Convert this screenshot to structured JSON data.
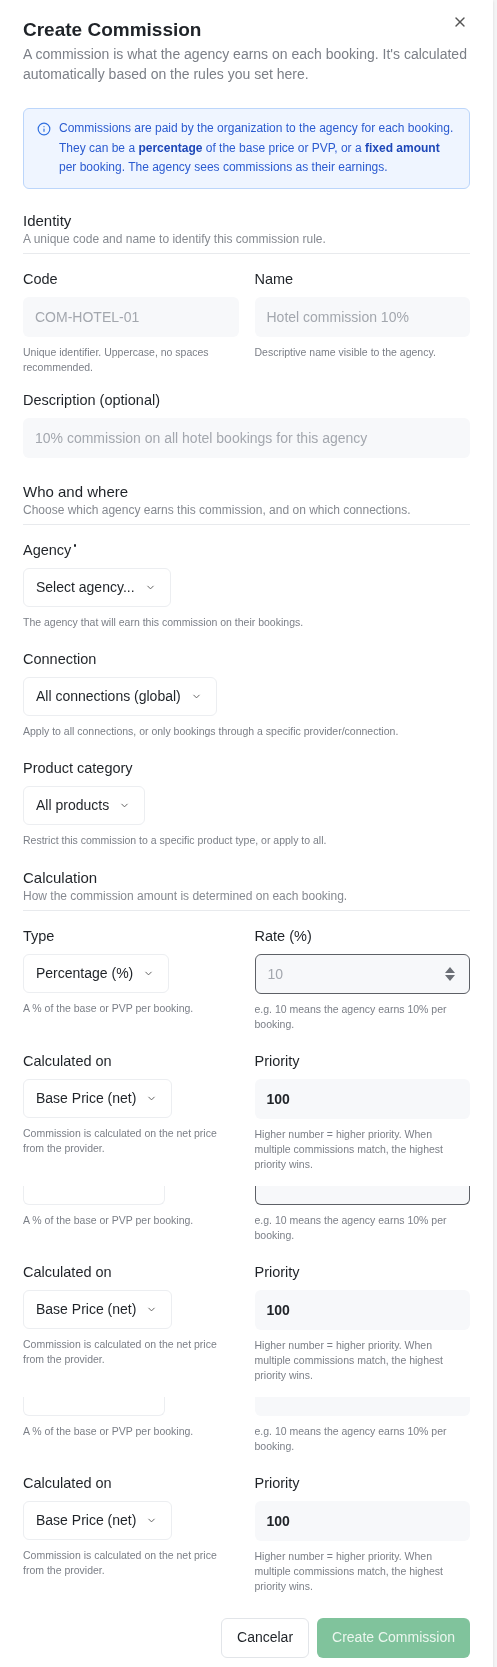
{
  "dialog": {
    "title": "Create Commission",
    "subtitle": "A commission is what the agency earns on each booking. It's calculated automatically based on the rules you set here.",
    "info": "Commissions are paid by the organization to the agency for each booking. They can be a **percentage** of the base price or PVP, or a **fixed amount** per booking. The agency sees commissions as their earnings."
  },
  "identity": {
    "title": "Identity",
    "subtitle": "A unique code and name to identify this commission rule.",
    "code": {
      "label": "Code",
      "placeholder": "COM-HOTEL-01",
      "hint": "Unique identifier. Uppercase, no spaces recommended."
    },
    "name": {
      "label": "Name",
      "placeholder": "Hotel commission 10%",
      "hint": "Descriptive name visible to the agency."
    },
    "description": {
      "label": "Description (optional)",
      "placeholder": "10% commission on all hotel bookings for this agency"
    }
  },
  "who_and_where": {
    "title": "Who and where",
    "subtitle": "Choose which agency earns this commission, and on which connections.",
    "fields": [
      {
        "label": "Agency",
        "required": true,
        "value": "Select agency...",
        "hint": "The agency that will earn this commission on their bookings."
      },
      {
        "label": "Connection",
        "required": false,
        "value": "All connections (global)",
        "hint": "Apply to all connections, or only bookings through a specific provider/connection."
      },
      {
        "label": "Product category",
        "required": false,
        "value": "All products",
        "hint": "Restrict this commission to a specific product type, or apply to all."
      }
    ]
  },
  "calculation": {
    "title": "Calculation",
    "subtitle": "How the commission amount is determined on each booking.",
    "type": {
      "label": "Type",
      "value": "Percentage (%)",
      "hint": "A % of the base or PVP per booking."
    },
    "rate": {
      "label": "Rate (%)",
      "placeholder": "10",
      "focused": true,
      "hint": "e.g. 10 means the agency earns 10% per booking."
    },
    "calculated_on": {
      "label": "Calculated on",
      "value": "Base Price (net)",
      "hint": "Commission is calculated on the net price from the provider."
    },
    "priority": {
      "label": "Priority",
      "value": "100",
      "hint": "Higher number = higher priority. When multiple commissions match, the highest priority wins."
    }
  },
  "repeated_fragments": [
    {
      "rate_focused": true,
      "type_hint": "A % of the base or PVP per booking.",
      "rate_hint": "e.g. 10 means the agency earns 10% per booking.",
      "calculated_on": {
        "label": "Calculated on",
        "value": "Base Price (net)",
        "hint": "Commission is calculated on the net price from the provider."
      },
      "priority": {
        "label": "Priority",
        "value": "100",
        "hint": "Higher number = higher priority. When multiple commissions match, the highest priority wins."
      }
    },
    {
      "rate_focused": false,
      "type_hint": "A % of the base or PVP per booking.",
      "rate_hint": "e.g. 10 means the agency earns 10% per booking.",
      "calculated_on": {
        "label": "Calculated on",
        "value": "Base Price (net)",
        "hint": "Commission is calculated on the net price from the provider."
      },
      "priority": {
        "label": "Priority",
        "value": "100",
        "hint": "Higher number = higher priority. When multiple commissions match, the highest priority wins."
      }
    }
  ],
  "buttons": [
    {
      "kind": "secondary",
      "label": "Cancelar",
      "disabled": false
    },
    {
      "kind": "primary",
      "label": "Create Commission",
      "disabled": true
    }
  ]
}
